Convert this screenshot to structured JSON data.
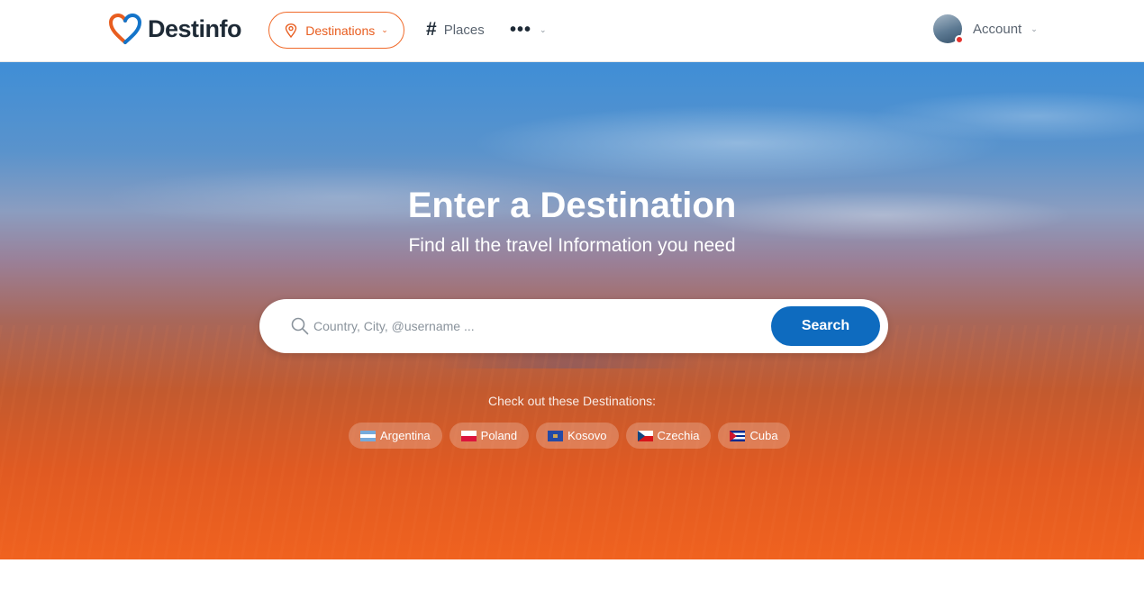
{
  "brand": {
    "name": "Destinfo",
    "colors": {
      "primary": "#0e6bbf",
      "accent": "#f06a2a",
      "dark": "#1e2a36"
    }
  },
  "nav": {
    "destinations": {
      "label": "Destinations",
      "icon": "map-pin-icon"
    },
    "places": {
      "label": "Places",
      "icon": "hash-icon"
    },
    "more": {
      "icon": "more-dots-icon"
    },
    "account": {
      "label": "Account",
      "icon": "avatar"
    }
  },
  "hero": {
    "title": "Enter a Destination",
    "subtitle": "Find all the travel Information you need",
    "search": {
      "placeholder": "Country, City, @username ...",
      "value": "",
      "button_label": "Search"
    },
    "suggestions_label": "Check out these Destinations:",
    "destinations": [
      {
        "label": "Argentina",
        "flag": "argentina-flag-icon"
      },
      {
        "label": "Poland",
        "flag": "poland-flag-icon"
      },
      {
        "label": "Kosovo",
        "flag": "kosovo-flag-icon"
      },
      {
        "label": "Czechia",
        "flag": "czechia-flag-icon"
      },
      {
        "label": "Cuba",
        "flag": "cuba-flag-icon"
      }
    ]
  }
}
